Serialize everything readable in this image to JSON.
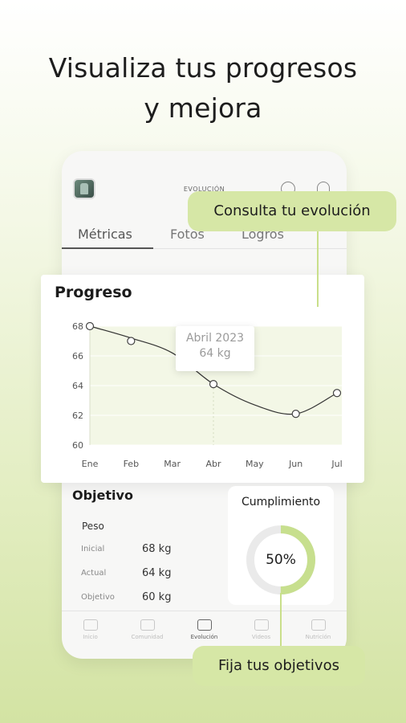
{
  "headline": {
    "line1": "Visualiza  tus progresos",
    "line2": "y mejora"
  },
  "app": {
    "title": "EVOLUCIÓN",
    "tabs": [
      "Métricas",
      "Fotos",
      "Logros"
    ],
    "active_tab": "Métricas"
  },
  "progress_card": {
    "title": "Progreso",
    "tooltip": {
      "month": "Abril 2023",
      "value": "64 kg"
    }
  },
  "chart_data": {
    "type": "line",
    "title": "Progreso",
    "x": [
      "Ene",
      "Feb",
      "Mar",
      "Abr",
      "May",
      "Jun",
      "Jul"
    ],
    "series": [
      {
        "values": [
          68,
          67,
          null,
          64.1,
          null,
          62.1,
          63.5
        ],
        "markers_at": [
          "Ene",
          "Feb",
          "Abr",
          "Jun",
          "Jul"
        ]
      }
    ],
    "curve_points": [
      [
        0,
        68
      ],
      [
        1,
        67.2
      ],
      [
        2,
        66.2
      ],
      [
        3,
        64.1
      ],
      [
        4,
        62.7
      ],
      [
        5,
        62.1
      ],
      [
        6,
        63.5
      ]
    ],
    "ylim": [
      60,
      68
    ],
    "yticks": [
      60,
      62,
      64,
      66,
      68
    ],
    "grid": true,
    "highlight": "Abr"
  },
  "objective": {
    "title": "Objetivo",
    "subtitle": "Peso",
    "rows": [
      {
        "label": "Inicial",
        "value": "68 kg"
      },
      {
        "label": "Actual",
        "value": "64 kg"
      },
      {
        "label": "Objetivo",
        "value": "60 kg"
      }
    ]
  },
  "fulfillment": {
    "title": "Cumplimiento",
    "percent_label": "50%",
    "percent": 50,
    "accent": "#c7df8e"
  },
  "nav": {
    "items": [
      "Inicio",
      "Comunidad",
      "Evolución",
      "Videos",
      "Nutrición"
    ],
    "active": "Evolución"
  },
  "callouts": {
    "top": "Consulta tu evolución",
    "bottom": "Fija tus objetivos"
  },
  "colors": {
    "accent": "#d6e7a6",
    "chart_fill": "#f2f6e6",
    "line": "#333333"
  }
}
